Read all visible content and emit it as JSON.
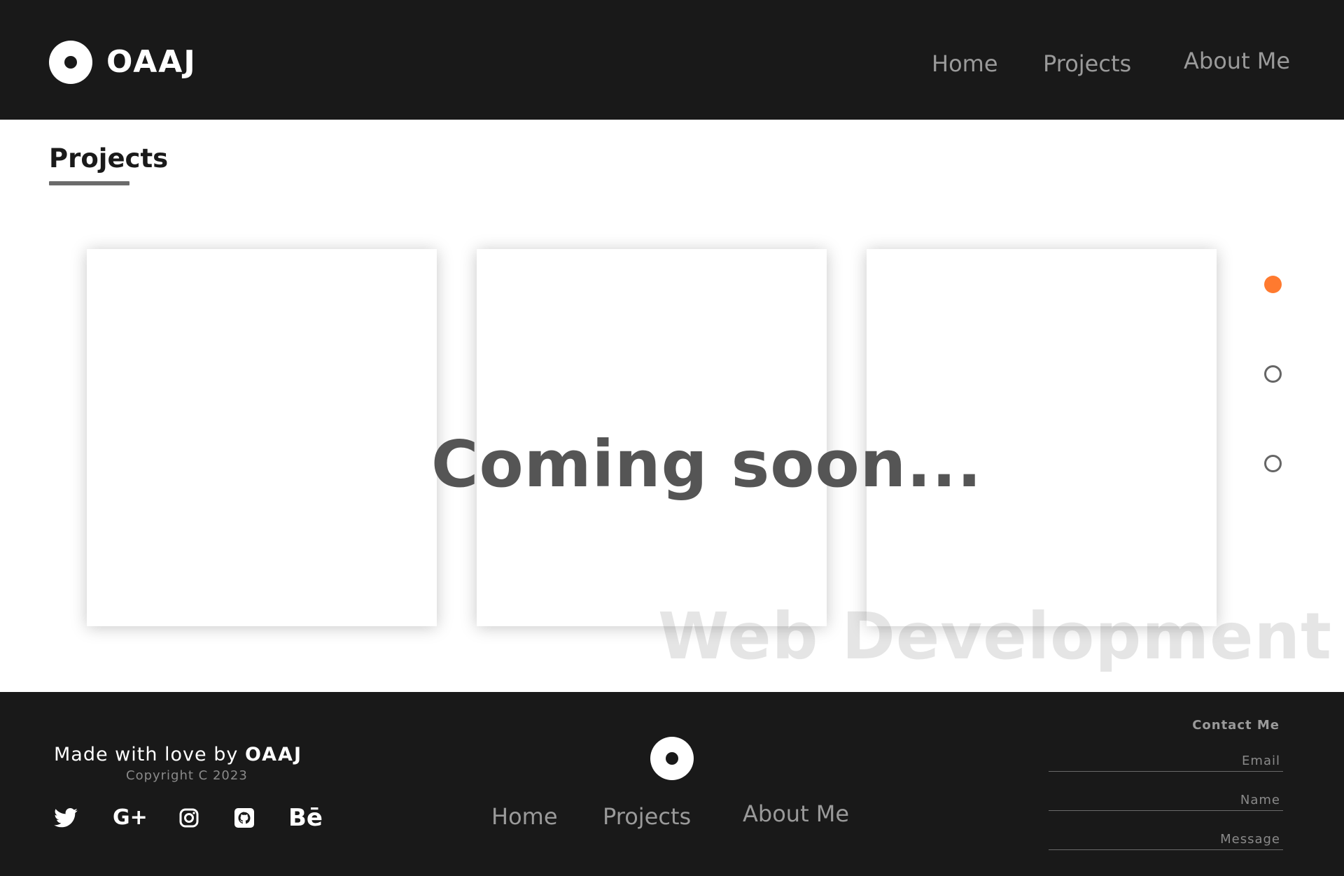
{
  "header": {
    "logo_text": "OAAJ",
    "nav": [
      "Home",
      "Projects",
      "About Me"
    ]
  },
  "main": {
    "section_title": "Projects",
    "coming_soon": "Coming soon...",
    "watermark": "Web Development",
    "slider": {
      "dot_count": 3,
      "active_index": 0,
      "active_color": "#ff7a2f"
    }
  },
  "footer": {
    "made_with_prefix": "Made with love by ",
    "made_with_brand": "OAAJ",
    "copyright": "Copyright C 2023",
    "social_icons": [
      "twitter-icon",
      "google-plus-icon",
      "instagram-icon",
      "github-icon",
      "behance-icon"
    ],
    "behance_label": "Bē",
    "gplus_label": "G+",
    "nav": [
      "Home",
      "Projects",
      "About Me"
    ],
    "contact": {
      "title": "Contact Me",
      "email_placeholder": "Email",
      "name_placeholder": "Name",
      "message_placeholder": "Message"
    }
  },
  "colors": {
    "header_bg": "#191919",
    "footer_bg": "#191919",
    "accent": "#ff7a2f"
  }
}
